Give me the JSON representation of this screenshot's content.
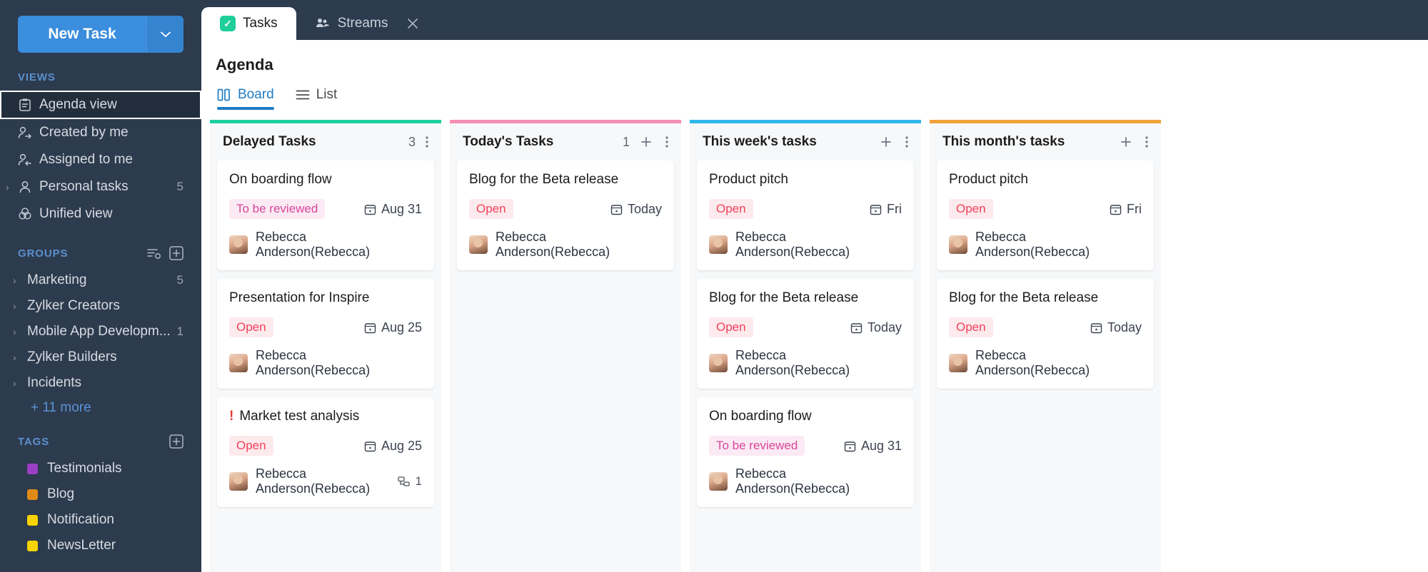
{
  "sidebar": {
    "new_task": {
      "label": "New Task",
      "dropdown_icon": "chevron-down-icon"
    },
    "views": {
      "heading": "VIEWS",
      "items": [
        {
          "label": "Agenda view",
          "icon": "agenda-icon",
          "count": "",
          "selected": true
        },
        {
          "label": "Created by me",
          "icon": "user-arrow-right-icon",
          "count": "",
          "selected": false
        },
        {
          "label": "Assigned to me",
          "icon": "user-arrow-left-icon",
          "count": "",
          "selected": false
        },
        {
          "label": "Personal tasks",
          "icon": "user-icon",
          "count": "5",
          "selected": false,
          "expandable": true
        },
        {
          "label": "Unified view",
          "icon": "venn-icon",
          "count": "",
          "selected": false
        }
      ]
    },
    "groups": {
      "heading": "GROUPS",
      "settings_icon": "list-settings-icon",
      "add_icon": "plus-box-icon",
      "items": [
        {
          "label": "Marketing",
          "count": "5"
        },
        {
          "label": "Zylker Creators",
          "count": ""
        },
        {
          "label": "Mobile App Developm...",
          "count": "1"
        },
        {
          "label": "Zylker Builders",
          "count": ""
        },
        {
          "label": "Incidents",
          "count": ""
        }
      ],
      "more_label": "+ 11 more"
    },
    "tags": {
      "heading": "TAGS",
      "add_icon": "plus-box-icon",
      "items": [
        {
          "label": "Testimonials",
          "color": "#9b3fc4"
        },
        {
          "label": "Blog",
          "color": "#e08a16"
        },
        {
          "label": "Notification",
          "color": "#f7d400"
        },
        {
          "label": "NewsLetter",
          "color": "#f7d400"
        }
      ]
    }
  },
  "tabbar": {
    "tabs": [
      {
        "label": "Tasks",
        "icon": "check-square-icon",
        "active": true,
        "closable": false
      },
      {
        "label": "Streams",
        "icon": "streams-icon",
        "active": false,
        "closable": true,
        "close_icon": "close-icon"
      }
    ]
  },
  "page": {
    "title": "Agenda",
    "view_tabs": [
      {
        "label": "Board",
        "icon": "board-icon",
        "active": true
      },
      {
        "label": "List",
        "icon": "list-icon",
        "active": false
      }
    ]
  },
  "board": {
    "columns": [
      {
        "title": "Delayed Tasks",
        "accent": "#1ecfa0",
        "count": "3",
        "show_add": false,
        "add_icon": "plus-icon",
        "menu_icon": "more-vertical-icon",
        "cards": [
          {
            "title": "On boarding flow",
            "priority": false,
            "status": {
              "label": "To be reviewed",
              "type": "review"
            },
            "due": {
              "label": "Aug 31",
              "icon": "calendar-icon"
            },
            "assignee": "Rebecca Anderson(Rebecca)",
            "subtask_count": ""
          },
          {
            "title": "Presentation for Inspire",
            "priority": false,
            "status": {
              "label": "Open",
              "type": "open"
            },
            "due": {
              "label": "Aug 25",
              "icon": "calendar-icon"
            },
            "assignee": "Rebecca Anderson(Rebecca)",
            "subtask_count": ""
          },
          {
            "title": "Market test analysis",
            "priority": true,
            "priority_icon": "priority-high-icon",
            "status": {
              "label": "Open",
              "type": "open"
            },
            "due": {
              "label": "Aug 25",
              "icon": "calendar-icon"
            },
            "assignee": "Rebecca Anderson(Rebecca)",
            "subtask_count": "1",
            "subtask_icon": "subtask-icon"
          }
        ]
      },
      {
        "title": "Today's Tasks",
        "accent": "#f58fb4",
        "count": "1",
        "show_add": true,
        "add_icon": "plus-icon",
        "menu_icon": "more-vertical-icon",
        "cards": [
          {
            "title": "Blog for the Beta release",
            "priority": false,
            "status": {
              "label": "Open",
              "type": "open"
            },
            "due": {
              "label": "Today",
              "icon": "calendar-icon"
            },
            "assignee": "Rebecca Anderson(Rebecca)",
            "subtask_count": ""
          }
        ]
      },
      {
        "title": "This week's tasks",
        "accent": "#31b7e8",
        "count": "",
        "show_add": true,
        "add_icon": "plus-icon",
        "menu_icon": "more-vertical-icon",
        "cards": [
          {
            "title": "Product pitch",
            "priority": false,
            "status": {
              "label": "Open",
              "type": "open"
            },
            "due": {
              "label": "Fri",
              "icon": "calendar-icon"
            },
            "assignee": "Rebecca Anderson(Rebecca)",
            "subtask_count": ""
          },
          {
            "title": "Blog for the Beta release",
            "priority": false,
            "status": {
              "label": "Open",
              "type": "open"
            },
            "due": {
              "label": "Today",
              "icon": "calendar-icon"
            },
            "assignee": "Rebecca Anderson(Rebecca)",
            "subtask_count": ""
          },
          {
            "title": "On boarding flow",
            "priority": false,
            "status": {
              "label": "To be reviewed",
              "type": "review"
            },
            "due": {
              "label": "Aug 31",
              "icon": "calendar-icon"
            },
            "assignee": "Rebecca Anderson(Rebecca)",
            "subtask_count": ""
          }
        ]
      },
      {
        "title": "This month's tasks",
        "accent": "#f0a23c",
        "count": "",
        "show_add": true,
        "add_icon": "plus-icon",
        "menu_icon": "more-vertical-icon",
        "cards": [
          {
            "title": "Product pitch",
            "priority": false,
            "status": {
              "label": "Open",
              "type": "open"
            },
            "due": {
              "label": "Fri",
              "icon": "calendar-icon"
            },
            "assignee": "Rebecca Anderson(Rebecca)",
            "subtask_count": ""
          },
          {
            "title": "Blog for the Beta release",
            "priority": false,
            "status": {
              "label": "Open",
              "type": "open"
            },
            "due": {
              "label": "Today",
              "icon": "calendar-icon"
            },
            "assignee": "Rebecca Anderson(Rebecca)",
            "subtask_count": ""
          }
        ]
      }
    ]
  }
}
